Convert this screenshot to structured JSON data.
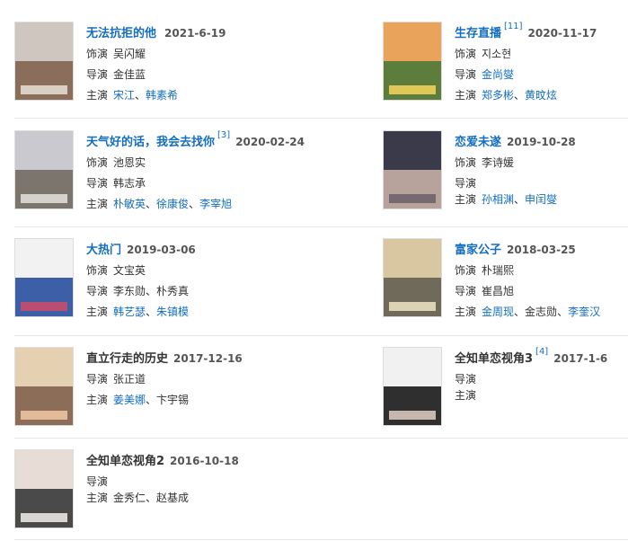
{
  "labels": {
    "role": "饰演",
    "director": "导演",
    "cast": "主演",
    "sep": "、"
  },
  "items": [
    {
      "title": "无法抗拒的他",
      "ref": "",
      "date": "2021-6-19",
      "role": "吴闪耀",
      "director": "金佳蓝",
      "cast": [
        {
          "n": "宋江",
          "l": true
        },
        {
          "n": "韩素希",
          "l": true
        }
      ],
      "colors": [
        "#cfc6bf",
        "#8a6e5b",
        "#e8e0d8"
      ]
    },
    {
      "title": "生存直播",
      "ref": "[11]",
      "date": "2020-11-17",
      "role": "지소현",
      "director": "金尚燮",
      "cast": [
        {
          "n": "郑多彬",
          "l": true
        },
        {
          "n": "黄旼炫",
          "l": true
        }
      ],
      "colors": [
        "#e9a35a",
        "#5d7d3c",
        "#f7d45a"
      ]
    },
    {
      "title": "天气好的话，我会去找你",
      "ref": "[3]",
      "date": "2020-02-24",
      "role": "池恩实",
      "director": "韩志承",
      "cast": [
        {
          "n": "朴敏英",
          "l": true
        },
        {
          "n": "徐康俊",
          "l": true
        },
        {
          "n": "李宰旭",
          "l": true
        }
      ],
      "colors": [
        "#c9c9cf",
        "#7b756e",
        "#e5e3df"
      ]
    },
    {
      "title": "恋爱未遂",
      "ref": "",
      "date": "2019-10-28",
      "role": "李诗媛",
      "director": "",
      "cast": [
        {
          "n": "孙相渊",
          "l": true
        },
        {
          "n": "申闰燮",
          "l": true
        }
      ],
      "colors": [
        "#3a3a4a",
        "#b7a39b",
        "#6d5e6a"
      ]
    },
    {
      "title": "大热门",
      "ref": "",
      "date": "2019-03-06",
      "role": "文宝英",
      "director": "李东勋、朴秀真",
      "cast": [
        {
          "n": "韩艺瑟",
          "l": true
        },
        {
          "n": "朱镇模",
          "l": true
        }
      ],
      "colors": [
        "#f2f2f2",
        "#3d5fa8",
        "#d04a68"
      ]
    },
    {
      "title": "富家公子",
      "ref": "",
      "date": "2018-03-25",
      "role": "朴瑞熙",
      "director": "崔昌旭",
      "cast": [
        {
          "n": "金周现",
          "l": true
        },
        {
          "n": "金志勋",
          "l": false
        },
        {
          "n": "李奎汉",
          "l": true
        }
      ],
      "colors": [
        "#d8c7a0",
        "#6f6a5a",
        "#f0e4c4"
      ]
    },
    {
      "title": "直立行走的历史",
      "ref": "",
      "date": "2017-12-16",
      "role": "",
      "director": "张正道",
      "cast": [
        {
          "n": "姜美娜",
          "l": true
        },
        {
          "n": "卞宇锡",
          "l": false
        }
      ],
      "colors": [
        "#e6d0b2",
        "#8c6e58",
        "#f1c8a5"
      ]
    },
    {
      "title": "全知单恋视角3",
      "ref": "[4]",
      "date": "2017-1-6",
      "role": "",
      "director": "",
      "cast": [],
      "colors": [
        "#f1f1f1",
        "#2f2f2f",
        "#e2cfc4"
      ]
    },
    {
      "title": "全知单恋视角2",
      "ref": "",
      "date": "2016-10-18",
      "role": "",
      "director": "",
      "cast": [
        {
          "n": "金秀仁",
          "l": false
        },
        {
          "n": "赵基成",
          "l": false
        }
      ],
      "colors": [
        "#e8ddd6",
        "#4a4a4a",
        "#f3efe9"
      ]
    }
  ]
}
